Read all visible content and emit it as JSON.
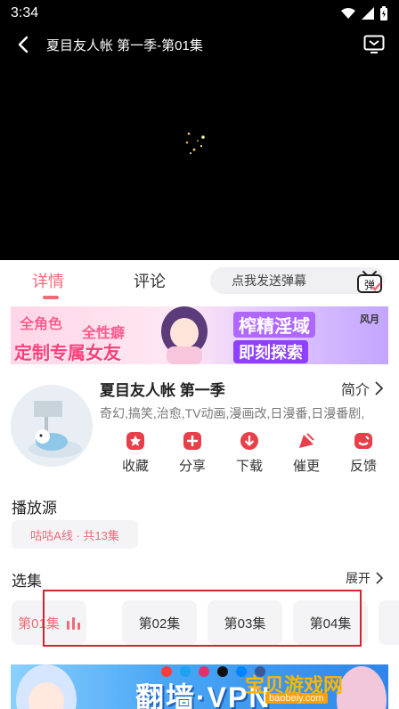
{
  "status_bar": {
    "time": "3:34"
  },
  "player": {
    "title": "夏目友人帐 第一季-第01集"
  },
  "tabs": {
    "details": "详情",
    "comments": "评论"
  },
  "danmaku": {
    "placeholder": "点我发送弹幕",
    "icon_label": "弹"
  },
  "banner_ad": {
    "text_a": "全角色",
    "text_b": "全性癖",
    "text_c": "定制专属女友",
    "text_d": "榨精淫域",
    "text_e": "即刻探索",
    "text_f": "风月"
  },
  "anime": {
    "title": "夏目友人帐 第一季",
    "intro_label": "简介",
    "tags": "奇幻,搞笑,治愈,TV动画,漫画改,日漫番,日漫番剧,"
  },
  "actions": [
    {
      "label": "收藏",
      "icon": "bookmark-icon"
    },
    {
      "label": "分享",
      "icon": "share-icon"
    },
    {
      "label": "下载",
      "icon": "download-icon"
    },
    {
      "label": "催更",
      "icon": "urge-update-icon"
    },
    {
      "label": "反馈",
      "icon": "feedback-icon"
    }
  ],
  "source": {
    "title": "播放源",
    "chip": "咕咕A线 · 共13集"
  },
  "episodes_section": {
    "title": "选集",
    "expand_label": "展开"
  },
  "episodes": [
    "第01集",
    "第02集",
    "第03集",
    "第04集"
  ],
  "bottom_banner": {
    "text": "翻墙·VPN"
  },
  "watermark": {
    "text": "宝贝游戏网",
    "url": "baobeiy.com"
  },
  "colors": {
    "accent": "#f06a78",
    "icon_red": "#e8404a",
    "highlight_border": "#d6232d"
  }
}
